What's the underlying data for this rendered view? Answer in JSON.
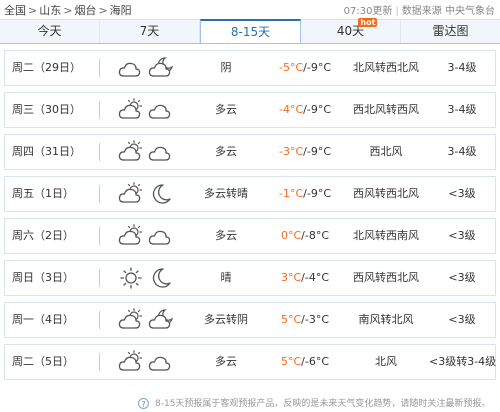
{
  "breadcrumb": {
    "items": [
      "全国",
      "山东",
      "烟台",
      "海阳"
    ],
    "separator": ">"
  },
  "update": {
    "time": "07:30更新",
    "source": "数据来源 中央气象台"
  },
  "tabs": [
    {
      "label": "今天",
      "active": false,
      "badge": ""
    },
    {
      "label": "7天",
      "active": false,
      "badge": ""
    },
    {
      "label": "8-15天",
      "active": true,
      "badge": ""
    },
    {
      "label": "40天",
      "active": false,
      "badge": "hot"
    },
    {
      "label": "雷达图",
      "active": false,
      "badge": ""
    }
  ],
  "forecast": [
    {
      "date": "周二（29日）",
      "icons": [
        "cloudy-icon",
        "cloudy-night-icon"
      ],
      "condition": "阴",
      "high": "-5°C",
      "low": "/-9°C",
      "wind": "北风转西北风",
      "level": "3-4级"
    },
    {
      "date": "周三（30日）",
      "icons": [
        "partly-cloudy-icon",
        "cloudy-icon"
      ],
      "condition": "多云",
      "high": "-4°C",
      "low": "/-9°C",
      "wind": "西北风转西风",
      "level": "3-4级"
    },
    {
      "date": "周四（31日）",
      "icons": [
        "partly-cloudy-icon",
        "cloudy-icon"
      ],
      "condition": "多云",
      "high": "-3°C",
      "low": "/-9°C",
      "wind": "西北风",
      "level": "3-4级"
    },
    {
      "date": "周五（1日）",
      "icons": [
        "partly-cloudy-icon",
        "moon-icon"
      ],
      "condition": "多云转晴",
      "high": "-1°C",
      "low": "/-9°C",
      "wind": "西风转西北风",
      "level": "<3级"
    },
    {
      "date": "周六（2日）",
      "icons": [
        "partly-cloudy-icon",
        "cloudy-icon"
      ],
      "condition": "多云",
      "high": "0°C",
      "low": "/-8°C",
      "wind": "北风转西南风",
      "level": "<3级"
    },
    {
      "date": "周日（3日）",
      "icons": [
        "sun-icon",
        "moon-icon"
      ],
      "condition": "晴",
      "high": "3°C",
      "low": "/-4°C",
      "wind": "西风转西北风",
      "level": "<3级"
    },
    {
      "date": "周一（4日）",
      "icons": [
        "partly-cloudy-icon",
        "cloudy-night-icon"
      ],
      "condition": "多云转阴",
      "high": "5°C",
      "low": "/-3°C",
      "wind": "南风转北风",
      "level": "<3级"
    },
    {
      "date": "周二（5日）",
      "icons": [
        "partly-cloudy-icon",
        "cloudy-icon"
      ],
      "condition": "多云",
      "high": "5°C",
      "low": "/-6°C",
      "wind": "北风",
      "level": "<3级转3-4级"
    }
  ],
  "note": {
    "icon": "?",
    "text": "8-15天预报属于客观预报产品，反映的是未来天气变化趋势，请随时关注最新预报。"
  },
  "colors": {
    "accent": "#2a6fb3",
    "high_temp": "#f26b1d",
    "hot_badge": "#f26b1d",
    "border": "#d9e4ef"
  }
}
